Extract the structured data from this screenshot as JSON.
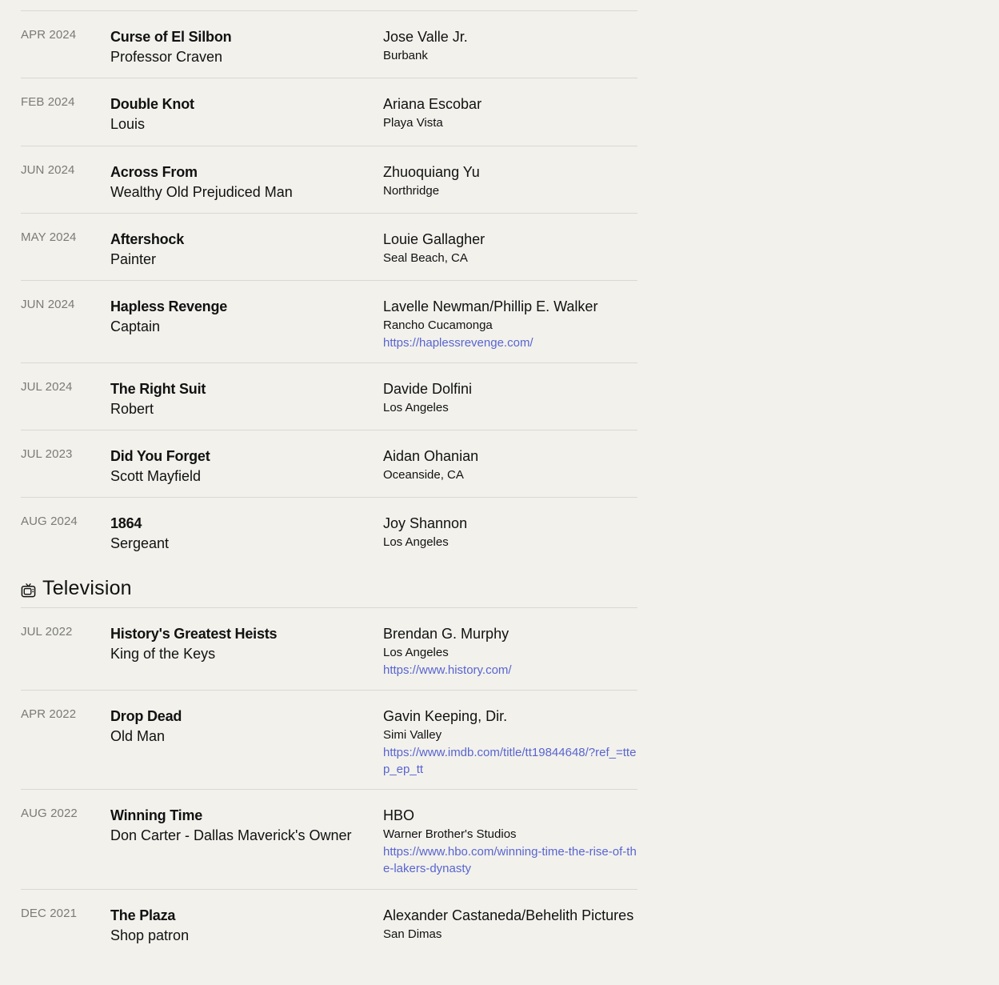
{
  "film_rows": [
    {
      "date": "APR 2024",
      "title": "Curse of El Silbon",
      "role": "Professor Craven",
      "director": "Jose Valle Jr.",
      "location": "Burbank",
      "link": ""
    },
    {
      "date": "FEB 2024",
      "title": "Double Knot",
      "role": "Louis",
      "director": "Ariana Escobar",
      "location": "Playa Vista",
      "link": ""
    },
    {
      "date": "JUN 2024",
      "title": "Across From",
      "role": "Wealthy Old Prejudiced Man",
      "director": "Zhuoquiang Yu",
      "location": "Northridge",
      "link": ""
    },
    {
      "date": "MAY 2024",
      "title": "Aftershock",
      "role": "Painter",
      "director": "Louie Gallagher",
      "location": "Seal Beach, CA",
      "link": ""
    },
    {
      "date": "JUN 2024",
      "title": "Hapless Revenge",
      "role": "Captain",
      "director": "Lavelle Newman/Phillip E. Walker",
      "location": "Rancho Cucamonga",
      "link": "https://haplessrevenge.com/"
    },
    {
      "date": "JUL 2024",
      "title": "The Right Suit",
      "role": "Robert",
      "director": "Davide Dolfini",
      "location": "Los Angeles",
      "link": ""
    },
    {
      "date": "JUL 2023",
      "title": "Did You Forget",
      "role": "Scott Mayfield",
      "director": "Aidan Ohanian",
      "location": "Oceanside, CA",
      "link": ""
    },
    {
      "date": "AUG 2024",
      "title": "1864",
      "role": "Sergeant",
      "director": "Joy Shannon",
      "location": "Los Angeles",
      "link": ""
    }
  ],
  "television": {
    "heading": "Television",
    "icon": "tv-icon",
    "rows": [
      {
        "date": "JUL 2022",
        "title": "History's Greatest Heists",
        "role": "King of the Keys",
        "director": "Brendan G. Murphy",
        "location": "Los Angeles",
        "link": "https://www.history.com/"
      },
      {
        "date": "APR 2022",
        "title": "Drop Dead",
        "role": "Old Man",
        "director": "Gavin Keeping, Dir.",
        "location": "Simi Valley",
        "link": "https://www.imdb.com/title/tt19844648/?ref_=ttep_ep_tt"
      },
      {
        "date": "AUG 2022",
        "title": "Winning Time",
        "role": "Don Carter - Dallas Maverick's Owner",
        "director": "HBO",
        "location": "Warner Brother's Studios",
        "link": "https://www.hbo.com/winning-time-the-rise-of-the-lakers-dynasty"
      },
      {
        "date": "DEC 2021",
        "title": "The Plaza",
        "role": "Shop patron",
        "director": "Alexander Castaneda/Behelith Pictures",
        "location": "San Dimas",
        "link": ""
      }
    ]
  },
  "colors": {
    "background": "#f2f1ec",
    "link": "#5865d0",
    "date": "#7b7b76",
    "divider": "#d9d8d2"
  }
}
